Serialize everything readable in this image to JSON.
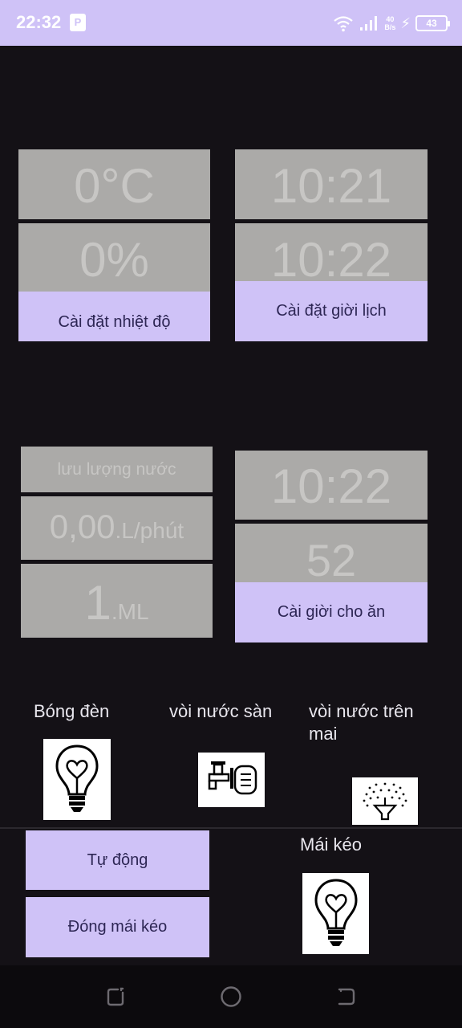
{
  "status_bar": {
    "time": "22:32",
    "app_icon_text": "P",
    "net_speed_value": "40",
    "net_speed_unit": "B/s",
    "battery": "43"
  },
  "climate": {
    "temperature": "0°C",
    "humidity": "0%",
    "set_button": "Cài đặt nhiệt độ"
  },
  "schedule": {
    "time_1": "10:21",
    "time_2": "10:22",
    "set_button": "Cài đặt giời lịch"
  },
  "water": {
    "title": "lưu lượng nước",
    "flow_value": "0,00",
    "flow_unit": ".L/phút",
    "volume_value": "1",
    "volume_unit": ".ML"
  },
  "feeding": {
    "time": "10:22",
    "amount": "52",
    "set_button": "Cài giời cho ăn"
  },
  "devices": {
    "bulb_label": "Bóng đèn",
    "floor_faucet_label": "vòi nước sàn",
    "roof_faucet_label": "vòi nước trên mai",
    "roof_label": "Mái kéo",
    "auto_button": "Tự động",
    "close_roof_button": "Đóng mái kéo"
  },
  "colors": {
    "accent": "#cfc2f7",
    "panel": "#abaaa8",
    "background": "#141116"
  }
}
